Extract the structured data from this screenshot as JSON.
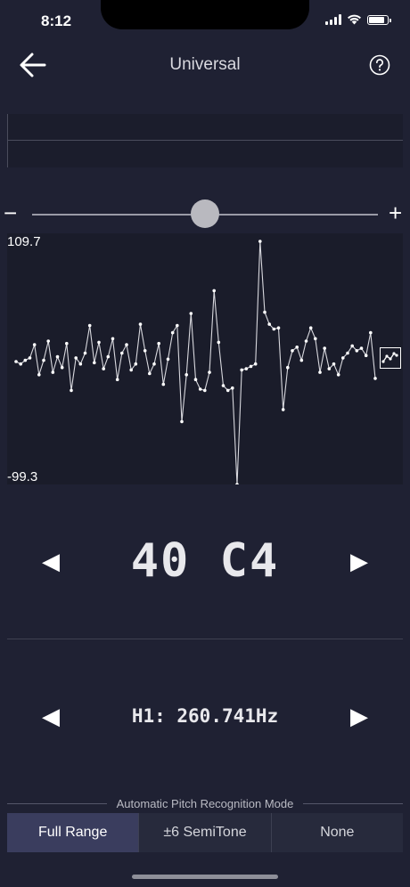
{
  "status": {
    "time": "8:12"
  },
  "nav": {
    "title": "Universal"
  },
  "slider": {
    "minus_label": "−",
    "plus_label": "+",
    "value_fraction": 0.5
  },
  "chart_data": {
    "type": "line",
    "max_label": "109.7",
    "min_label": "-99.3",
    "ylim": [
      -99.3,
      109.7
    ],
    "y": [
      3,
      1,
      4,
      6,
      17,
      -8,
      4,
      20,
      -6,
      7,
      -2,
      18,
      -21,
      6,
      1,
      10,
      33,
      2,
      19,
      -3,
      7,
      22,
      -12,
      10,
      17,
      -4,
      1,
      34,
      12,
      -7,
      1,
      18,
      -16,
      5,
      27,
      33,
      -47,
      -8,
      43,
      -12,
      -20,
      -21,
      -6,
      62,
      19,
      -17,
      -21,
      -19,
      -99.3,
      -4,
      -3,
      -1,
      1,
      103,
      44,
      34,
      30,
      31,
      -37,
      -2,
      12,
      15,
      4,
      20,
      31,
      22,
      -6,
      14,
      -3,
      1,
      -8,
      6,
      10,
      16,
      12,
      14,
      8,
      27,
      -11
    ]
  },
  "note": {
    "label": "40 C4",
    "prev_arrow": "◀",
    "next_arrow": "▶"
  },
  "frequency": {
    "label": "H1: 260.741Hz",
    "prev_arrow": "◀",
    "next_arrow": "▶"
  },
  "mode": {
    "title": "Automatic Pitch Recognition Mode",
    "options": [
      "Full Range",
      "±6 SemiTone",
      "None"
    ],
    "selected": "Full Range"
  }
}
